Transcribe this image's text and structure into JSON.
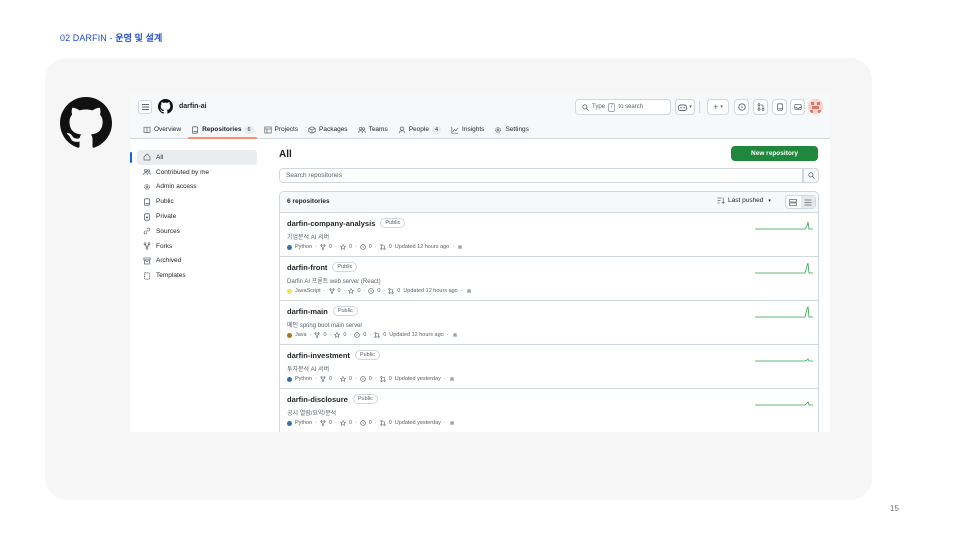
{
  "slide": {
    "title_prefix": "02 DARFIN - ",
    "title_rest": "운영 및 설계",
    "page_number": "15"
  },
  "topbar": {
    "org_name": "darfin-ai",
    "search_placeholder_pre": "Type",
    "search_key": "/",
    "search_placeholder_post": "to search"
  },
  "nav": {
    "tabs": [
      {
        "label": "Overview",
        "icon": "book-icon"
      },
      {
        "label": "Repositories",
        "icon": "repo-icon",
        "count": "6",
        "selected": true
      },
      {
        "label": "Projects",
        "icon": "table-icon"
      },
      {
        "label": "Packages",
        "icon": "package-icon"
      },
      {
        "label": "Teams",
        "icon": "people-icon"
      },
      {
        "label": "People",
        "icon": "person-icon",
        "count": "4"
      },
      {
        "label": "Insights",
        "icon": "graph-icon"
      },
      {
        "label": "Settings",
        "icon": "gear-icon"
      }
    ]
  },
  "sidebar": {
    "items": [
      {
        "label": "All",
        "icon": "home-icon",
        "selected": true
      },
      {
        "label": "Contributed by me",
        "icon": "people-icon"
      },
      {
        "label": "Admin access",
        "icon": "gear-icon"
      },
      {
        "label": "Public",
        "icon": "repo-icon"
      },
      {
        "label": "Private",
        "icon": "lock-repo-icon"
      },
      {
        "label": "Sources",
        "icon": "link-icon"
      },
      {
        "label": "Forks",
        "icon": "fork-icon"
      },
      {
        "label": "Archived",
        "icon": "archive-icon"
      },
      {
        "label": "Templates",
        "icon": "template-icon"
      }
    ]
  },
  "main": {
    "title": "All",
    "new_repo_label": "New repository",
    "search_placeholder": "Search repositories",
    "repo_count_label": "6 repositories",
    "sort_label": "Last pushed"
  },
  "repos": [
    {
      "name": "darfin-company-analysis",
      "visibility": "Public",
      "description": "기업분석 AI 서버",
      "language": "Python",
      "lang_color": "#3572A5",
      "forks": "0",
      "stars": "0",
      "issues": "0",
      "prs": "0",
      "updated": "Updated 12 hours ago"
    },
    {
      "name": "darfin-front",
      "visibility": "Public",
      "description": "Darfin AI 프론트 web server (React)",
      "language": "JavaScript",
      "lang_color": "#f1e05a",
      "forks": "0",
      "stars": "0",
      "issues": "0",
      "prs": "0",
      "updated": "Updated 12 hours ago"
    },
    {
      "name": "darfin-main",
      "visibility": "Public",
      "description": "메인 spring boot main server",
      "language": "Java",
      "lang_color": "#b07219",
      "forks": "0",
      "stars": "0",
      "issues": "0",
      "prs": "0",
      "updated": "Updated 12 hours ago"
    },
    {
      "name": "darfin-investment",
      "visibility": "Public",
      "description": "투자분석 AI 서버",
      "language": "Python",
      "lang_color": "#3572A5",
      "forks": "0",
      "stars": "0",
      "issues": "0",
      "prs": "0",
      "updated": "Updated yesterday"
    },
    {
      "name": "darfin-disclosure",
      "visibility": "Public",
      "description": "공시 열람/요약/분석",
      "language": "Python",
      "lang_color": "#3572A5",
      "forks": "0",
      "stars": "0",
      "issues": "0",
      "prs": "0",
      "updated": "Updated yesterday"
    }
  ],
  "colors": {
    "accent_green": "#1f883d",
    "tab_underline": "#fd8c73",
    "slide_title_blue": "#1f4fd6",
    "sparkline": "#2da44e"
  }
}
